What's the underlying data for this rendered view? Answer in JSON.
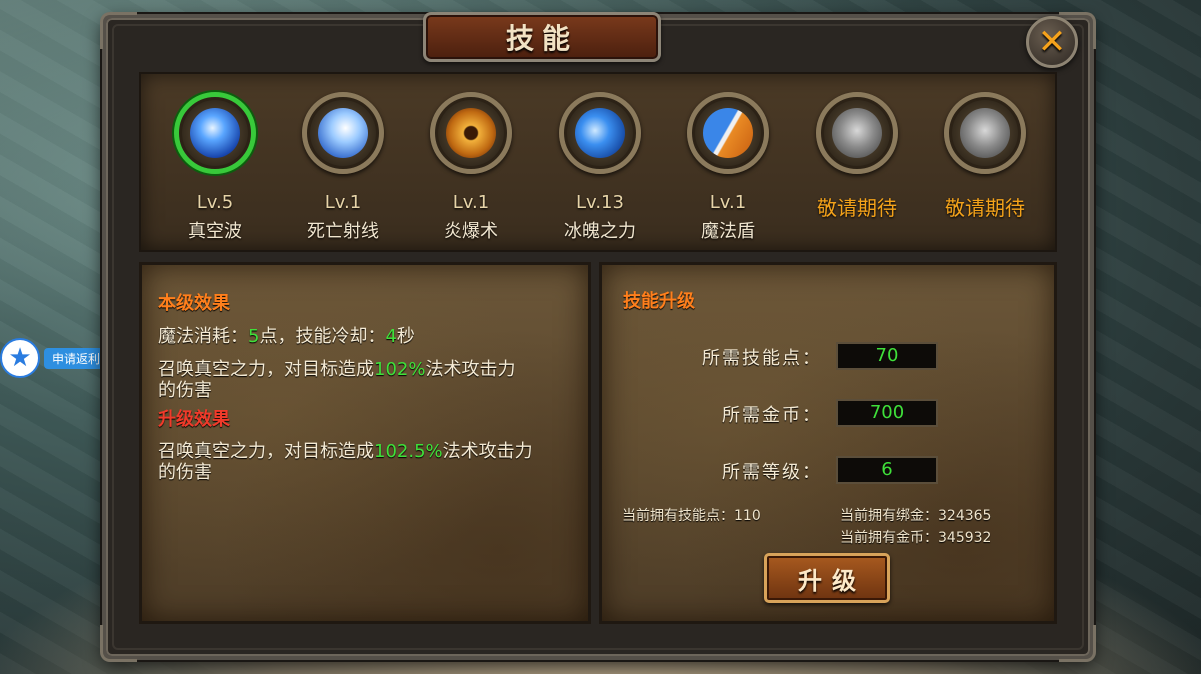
{
  "window": {
    "title": "技能",
    "close_icon": "close-icon"
  },
  "skills": [
    {
      "level": "Lv.5",
      "name": "真空波",
      "icon": "vacuum-wave-icon",
      "selected": true
    },
    {
      "level": "Lv.1",
      "name": "死亡射线",
      "icon": "death-ray-icon",
      "selected": false
    },
    {
      "level": "Lv.1",
      "name": "炎爆术",
      "icon": "pyroblast-icon",
      "selected": false
    },
    {
      "level": "Lv.13",
      "name": "冰魄之力",
      "icon": "ice-soul-icon",
      "selected": false
    },
    {
      "level": "Lv.1",
      "name": "魔法盾",
      "icon": "magic-shield-icon",
      "selected": false
    },
    {
      "coming_soon": "敬请期待",
      "icon": "locked-skill-icon"
    },
    {
      "coming_soon": "敬请期待",
      "icon": "locked-skill-icon"
    }
  ],
  "current_effect": {
    "title": "本级效果",
    "mana_label": "魔法消耗：",
    "mana_value": "5",
    "mana_unit": "点，技能冷却：",
    "cooldown_value": "4",
    "cooldown_unit": "秒",
    "desc_prefix": "召唤真空之力，对目标造成",
    "desc_value": "102%",
    "desc_suffix": "法术攻击力",
    "desc_line2": "的伤害"
  },
  "upgrade_effect": {
    "title": "升级效果",
    "desc_prefix": "召唤真空之力，对目标造成",
    "desc_value": "102.5%",
    "desc_suffix": "法术攻击力",
    "desc_line2": "的伤害"
  },
  "skill_upgrade": {
    "title": "技能升级",
    "required_points_label": "所需技能点：",
    "required_points": "70",
    "required_gold_label": "所需金币：",
    "required_gold": "700",
    "required_level_label": "所需等级：",
    "required_level": "6",
    "owned_points": "当前拥有技能点：110",
    "owned_bound_gold": "当前拥有绑金：324365",
    "owned_gold": "当前拥有金币：345932",
    "upgrade_button": "升级"
  },
  "side_widget": {
    "label": "申请返利",
    "icon": "star-icon"
  },
  "colors": {
    "accent_orange": "#ff7f1c",
    "accent_red": "#f03a2a",
    "value_green": "#3fe03a",
    "coming_soon": "#f3a21a",
    "selected_ring": "#38c93a"
  }
}
